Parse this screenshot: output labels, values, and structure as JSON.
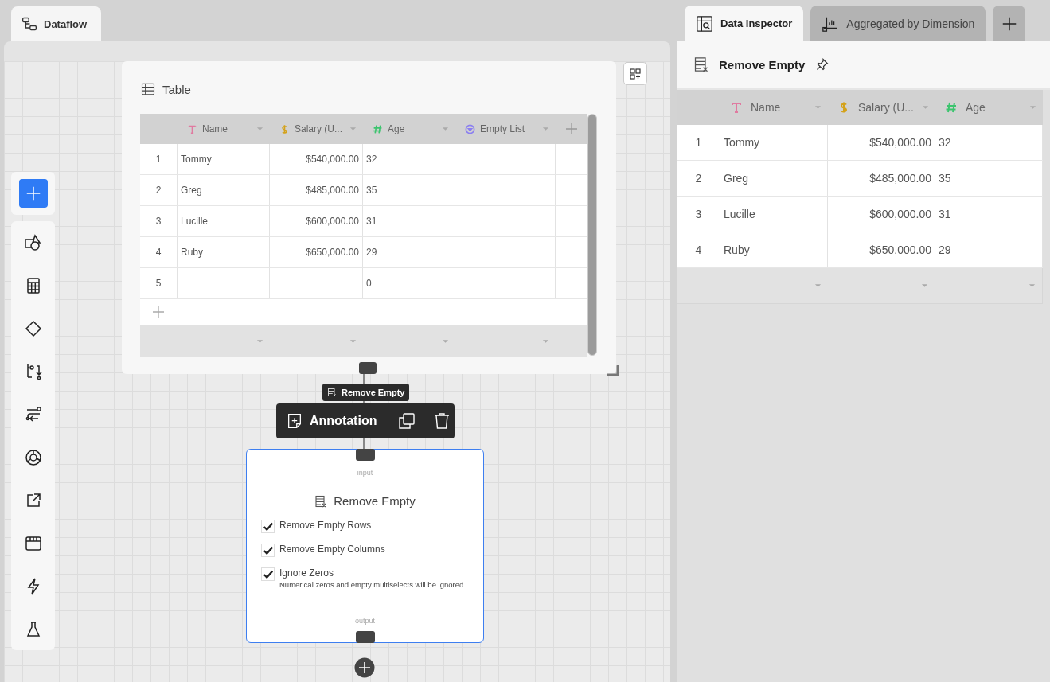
{
  "flow_tabs": [
    {
      "label": "Dataflow",
      "selected": true
    }
  ],
  "canvas": {
    "table_node": {
      "title": "Table",
      "columns": [
        {
          "name": "Name",
          "kind": "text",
          "color": "#e07aa0"
        },
        {
          "name": "Salary (U...",
          "kind": "currency",
          "color": "#d4a21a"
        },
        {
          "name": "Age",
          "kind": "number",
          "color": "#3cc46e"
        },
        {
          "name": "Empty List",
          "kind": "list",
          "color": "#8b7ff0"
        }
      ],
      "rows": [
        {
          "index": "1",
          "cells": [
            "Tommy",
            "$540,000.00",
            "32",
            null
          ]
        },
        {
          "index": "2",
          "cells": [
            "Greg",
            "$485,000.00",
            "35",
            null
          ]
        },
        {
          "index": "3",
          "cells": [
            "Lucille",
            "$600,000.00",
            "31",
            null
          ]
        },
        {
          "index": "4",
          "cells": [
            "Ruby",
            "$650,000.00",
            "29",
            null
          ]
        },
        {
          "index": "5",
          "cells": [
            null,
            null,
            "0",
            null
          ]
        }
      ]
    },
    "node_tooltip": "Remove Empty",
    "node_toolbar": {
      "annotation_label": "Annotation"
    },
    "remove_node": {
      "selected": true,
      "input_label": "input",
      "title": "Remove Empty",
      "output_label": "output",
      "options": [
        {
          "label": "Remove Empty Rows",
          "checked": true
        },
        {
          "label": "Remove Empty Columns",
          "checked": true
        },
        {
          "label": "Ignore Zeros",
          "hint": "Numerical zeros and empty multiselects will be ignored",
          "checked": true
        }
      ]
    }
  },
  "inspector_tabs": [
    {
      "label": "Data Inspector",
      "kind": "inspector",
      "selected": true
    },
    {
      "label": "Aggregated by Dimension",
      "kind": "chart",
      "selected": false
    }
  ],
  "inspector": {
    "title": "Remove Empty",
    "columns": [
      {
        "name": "Name",
        "kind": "text",
        "color": "#e07aa0"
      },
      {
        "name": "Salary (U...",
        "kind": "currency",
        "color": "#d4a21a"
      },
      {
        "name": "Age",
        "kind": "number",
        "color": "#3cc46e"
      }
    ],
    "rows": [
      {
        "index": "1",
        "cells": [
          "Tommy",
          "$540,000.00",
          "32"
        ]
      },
      {
        "index": "2",
        "cells": [
          "Greg",
          "$485,000.00",
          "35"
        ]
      },
      {
        "index": "3",
        "cells": [
          "Lucille",
          "$600,000.00",
          "31"
        ]
      },
      {
        "index": "4",
        "cells": [
          "Ruby",
          "$650,000.00",
          "29"
        ]
      }
    ]
  }
}
